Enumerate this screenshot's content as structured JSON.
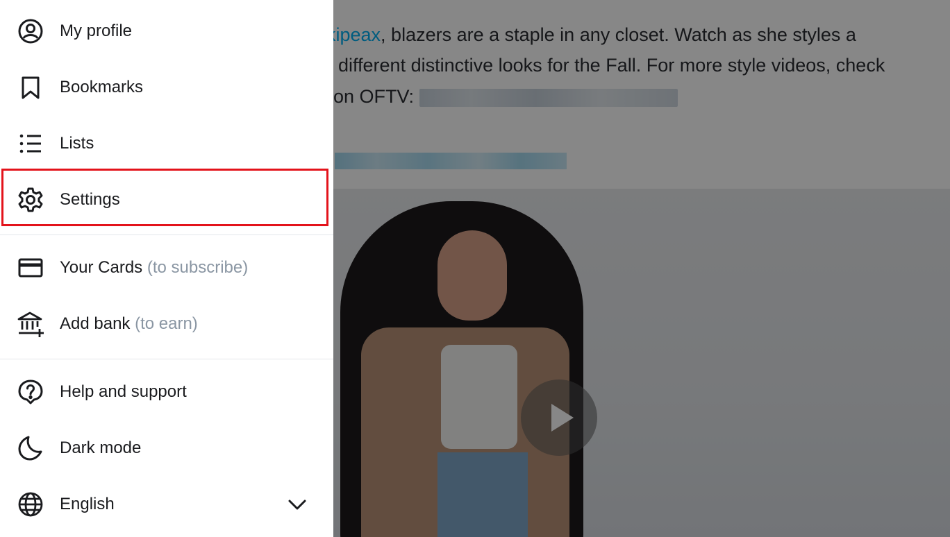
{
  "background_post": {
    "mention": "kipeax",
    "line1_rest": ", blazers are a staple in any closet. Watch as she styles a",
    "line2": "different distinctive looks for the Fall. For more style videos, check",
    "line3": "on OFTV:"
  },
  "menu": {
    "items": [
      {
        "label": "My profile",
        "icon": "profile-icon"
      },
      {
        "label": "Bookmarks",
        "icon": "bookmark-icon"
      },
      {
        "label": "Lists",
        "icon": "lists-icon"
      },
      {
        "label": "Settings",
        "icon": "gear-icon",
        "highlighted": true
      },
      {
        "label": "Your Cards",
        "note": "(to subscribe)",
        "icon": "card-icon"
      },
      {
        "label": "Add bank",
        "note": "(to earn)",
        "icon": "bank-icon"
      },
      {
        "label": "Help and support",
        "icon": "help-icon"
      },
      {
        "label": "Dark mode",
        "icon": "moon-icon"
      },
      {
        "label": "English",
        "icon": "globe-icon",
        "dropdown": true
      }
    ]
  },
  "colors": {
    "highlight": "#e3131b",
    "note_text": "#8a96a3",
    "link": "#00aff0"
  }
}
